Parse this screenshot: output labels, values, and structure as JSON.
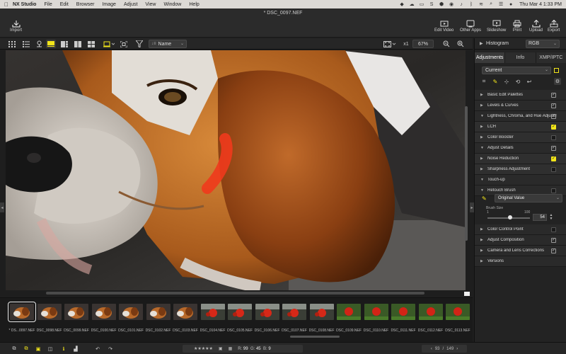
{
  "menubar": {
    "apple_icon": "apple-icon",
    "items": [
      "NX Studio",
      "File",
      "Edit",
      "Browser",
      "Image",
      "Adjust",
      "View",
      "Window",
      "Help"
    ],
    "clock": "Thu Mar 4  1:33 PM"
  },
  "window": {
    "title": "* DSC_0097.NEF"
  },
  "toolbar": {
    "import_label": "Import",
    "edit_video_label": "Edit Video",
    "other_apps_label": "Other Apps",
    "slideshow_label": "Slideshow",
    "print_label": "Print",
    "upload_label": "Upload",
    "export_label": "Export"
  },
  "viewbar": {
    "sort_label": "Name",
    "zoom_x1": "x1",
    "zoom_percent": "67%"
  },
  "filmstrip": {
    "thumbnails": [
      {
        "label": "* DS...0097.NEF",
        "kind": "dog"
      },
      {
        "label": "DSC_0098.NEF",
        "kind": "dog"
      },
      {
        "label": "DSC_0099.NEF",
        "kind": "dog"
      },
      {
        "label": "DSC_0100.NEF",
        "kind": "dog"
      },
      {
        "label": "DSC_0101.NEF",
        "kind": "dog"
      },
      {
        "label": "DSC_0102.NEF",
        "kind": "dog"
      },
      {
        "label": "DSC_0103.NEF",
        "kind": "dog"
      },
      {
        "label": "DSC_0104.NEF",
        "kind": "flower"
      },
      {
        "label": "DSC_0105.NEF",
        "kind": "flower"
      },
      {
        "label": "DSC_0106.NEF",
        "kind": "flower"
      },
      {
        "label": "DSC_0107.NEF",
        "kind": "flower"
      },
      {
        "label": "DSC_0108.NEF",
        "kind": "flower"
      },
      {
        "label": "DSC_0109.NEF",
        "kind": "green"
      },
      {
        "label": "DSC_0110.NEF",
        "kind": "green"
      },
      {
        "label": "DSC_0111.NEF",
        "kind": "green"
      },
      {
        "label": "DSC_0112.NEF",
        "kind": "green"
      },
      {
        "label": "DSC_0113.NEF",
        "kind": "green"
      }
    ]
  },
  "bottombar": {
    "r_label": "R:",
    "r_value": "99",
    "g_label": "G:",
    "g_value": "45",
    "b_label": "B:",
    "b_value": "9",
    "page_current": "93",
    "page_sep": "/",
    "page_total": "149"
  },
  "right_panel": {
    "histogram_label": "Histogram",
    "histogram_channel": "RGB",
    "tabs": [
      "Adjustments",
      "Info",
      "XMP/IPTC"
    ],
    "preset": "Current",
    "rows": [
      {
        "label": "Basic Edit Palettes",
        "tri": "▶",
        "check": "plain"
      },
      {
        "label": "Levels & Curves",
        "tri": "▶",
        "check": "plain"
      },
      {
        "label": "Lightness, Chroma, and Hue Adjustment",
        "tri": "▼",
        "check": "plain"
      },
      {
        "label": "LCH",
        "tri": "▶",
        "check": "on"
      },
      {
        "label": "Color Booster",
        "tri": "▶",
        "check": "dark"
      },
      {
        "label": "Adjust Details",
        "tri": "▼",
        "check": "plain"
      },
      {
        "label": "Noise Reduction",
        "tri": "▶",
        "check": "on"
      },
      {
        "label": "Sharpness Adjustment",
        "tri": "▶",
        "check": "dark"
      },
      {
        "label": "Touch-up",
        "tri": "▼",
        "check": "none"
      },
      {
        "label": "Retouch Brush",
        "tri": "▼",
        "check": "dark"
      }
    ],
    "overlay_value": "Original Value",
    "brush_size_label": "Brush Size",
    "brush_min": "1",
    "brush_max": "100",
    "brush_value": "54",
    "brush_level": 0.54,
    "rows2": [
      {
        "label": "Color Control Point",
        "tri": "▶",
        "check": "dark"
      },
      {
        "label": "Adjust Composition",
        "tri": "▶",
        "check": "plain"
      },
      {
        "label": "Camera and Lens Corrections",
        "tri": "▶",
        "check": "plain"
      },
      {
        "label": "Versions",
        "tri": "▶",
        "check": "none"
      }
    ]
  },
  "colors": {
    "accent_yellow": "#f2e51a",
    "panel_bg": "#232323",
    "brush_red": "#f03a1c"
  }
}
